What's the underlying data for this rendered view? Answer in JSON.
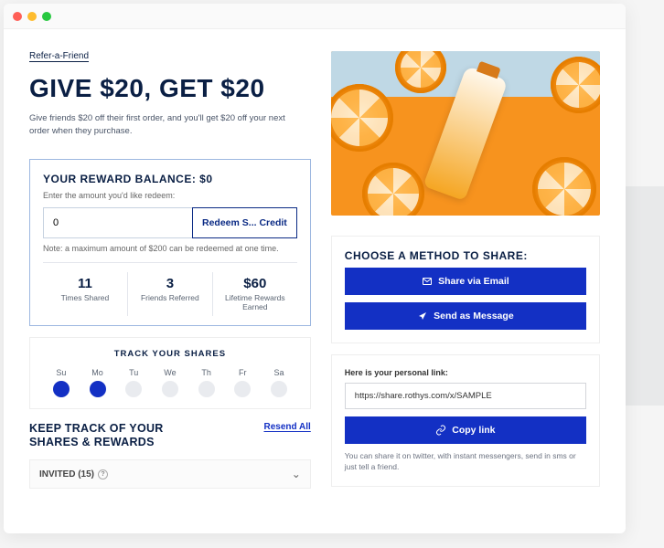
{
  "breadcrumb": "Refer-a-Friend",
  "headline": "GIVE $20, GET $20",
  "subcopy": "Give friends $20 off their first order, and you'll get $20 off your next order when they purchase.",
  "reward": {
    "title": "YOUR REWARD BALANCE: $0",
    "enter_label": "Enter the amount you'd like redeem:",
    "input_value": "0",
    "redeem_button": "Redeem S... Credit",
    "note": "Note: a maximum amount of $200 can be redeemed at one time."
  },
  "stats": [
    {
      "value": "11",
      "label": "Times Shared"
    },
    {
      "value": "3",
      "label": "Friends Referred"
    },
    {
      "value": "$60",
      "label": "Lifetime Rewards Earned"
    }
  ],
  "track": {
    "title": "TRACK YOUR SHARES",
    "days": [
      {
        "abbr": "Su",
        "selected": true
      },
      {
        "abbr": "Mo",
        "selected": true
      },
      {
        "abbr": "Tu",
        "selected": false
      },
      {
        "abbr": "We",
        "selected": false
      },
      {
        "abbr": "Th",
        "selected": false
      },
      {
        "abbr": "Fr",
        "selected": false
      },
      {
        "abbr": "Sa",
        "selected": false
      }
    ]
  },
  "keep": {
    "title_l1": "KEEP TRACK OF YOUR",
    "title_l2": "SHARES & REWARDS",
    "resend": "Resend All",
    "invited_label": "INVITED (15)"
  },
  "share": {
    "title": "CHOOSE A METHOD TO SHARE:",
    "email_btn": "Share via Email",
    "message_btn": "Send as Message",
    "link_label": "Here is your personal link:",
    "link_value": "https://share.rothys.com/x/SAMPLE",
    "copy_btn": "Copy link",
    "tiny": "You can share it on twitter, with instant messengers, send in sms or just tell a friend."
  }
}
